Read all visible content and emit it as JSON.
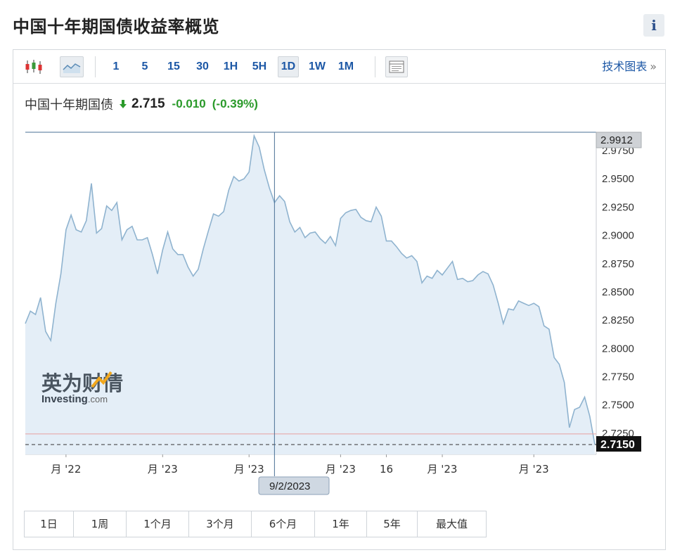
{
  "page": {
    "title": "中国十年期国债收益率概览",
    "info_label": "i"
  },
  "toolbar": {
    "intervals": [
      "1",
      "5",
      "15",
      "30",
      "1H",
      "5H",
      "1D",
      "1W",
      "1M"
    ],
    "active_interval": "1D",
    "tech_chart_label": "技术图表",
    "tech_chart_chevron": "»",
    "icons": [
      "candlestick-icon",
      "area-chart-icon",
      "chart-settings-icon"
    ]
  },
  "quote": {
    "name": "中国十年期国债",
    "price": "2.715",
    "change": "-0.010",
    "change_pct": "(-0.39%)",
    "direction": "down",
    "color_change": "#2a9a2a"
  },
  "watermark": {
    "brand_cn": "英为财情",
    "brand_en": "Investing",
    "brand_suffix": ".com"
  },
  "chart_data": {
    "type": "area",
    "ylim": [
      2.715,
      2.9912
    ],
    "y_ticks": [
      "2.9750",
      "2.9500",
      "2.9250",
      "2.9000",
      "2.8750",
      "2.8500",
      "2.8250",
      "2.8000",
      "2.7750",
      "2.7500",
      "2.7250"
    ],
    "y_tick_values": [
      2.975,
      2.95,
      2.925,
      2.9,
      2.875,
      2.85,
      2.825,
      2.8,
      2.775,
      2.75,
      2.725
    ],
    "x_tick_labels": [
      "月 '22",
      "月 '23",
      "月 '23",
      "月 '23",
      "16",
      "月 '23",
      "月 '23"
    ],
    "x_tick_index": [
      8,
      27,
      44,
      62,
      71,
      82,
      100
    ],
    "crosshair": {
      "index": 49,
      "date_label": "9/2/2023",
      "value_label": "2.9912"
    },
    "last_value_label": "2.7150",
    "reference_line_value": 2.7244,
    "colors": {
      "line": "#8fb3cf",
      "fill": "#e4eef7",
      "crosshair": "#4a6f95",
      "reference": "#e8a0a0",
      "last_badge": "#111111"
    },
    "series": [
      {
        "values": [
          2.822,
          2.833,
          2.83,
          2.845,
          2.815,
          2.807,
          2.84,
          2.866,
          2.905,
          2.918,
          2.905,
          2.903,
          2.913,
          2.946,
          2.902,
          2.906,
          2.926,
          2.922,
          2.929,
          2.896,
          2.905,
          2.908,
          2.896,
          2.896,
          2.898,
          2.883,
          2.866,
          2.887,
          2.903,
          2.888,
          2.883,
          2.883,
          2.872,
          2.864,
          2.87,
          2.888,
          2.904,
          2.919,
          2.917,
          2.921,
          2.94,
          2.952,
          2.948,
          2.95,
          2.956,
          2.988,
          2.978,
          2.958,
          2.942,
          2.929,
          2.935,
          2.93,
          2.912,
          2.903,
          2.907,
          2.898,
          2.902,
          2.903,
          2.897,
          2.893,
          2.899,
          2.891,
          2.915,
          2.92,
          2.922,
          2.923,
          2.916,
          2.913,
          2.912,
          2.925,
          2.917,
          2.895,
          2.895,
          2.89,
          2.884,
          2.88,
          2.882,
          2.877,
          2.858,
          2.864,
          2.862,
          2.869,
          2.865,
          2.871,
          2.877,
          2.861,
          2.862,
          2.859,
          2.86,
          2.865,
          2.868,
          2.866,
          2.856,
          2.84,
          2.822,
          2.835,
          2.834,
          2.842,
          2.84,
          2.838,
          2.84,
          2.837,
          2.82,
          2.817,
          2.792,
          2.786,
          2.77,
          2.73,
          2.746,
          2.748,
          2.757,
          2.74,
          2.715
        ]
      }
    ]
  },
  "ranges": [
    "1日",
    "1周",
    "1个月",
    "3个月",
    "6个月",
    "1年",
    "5年",
    "最大值"
  ]
}
